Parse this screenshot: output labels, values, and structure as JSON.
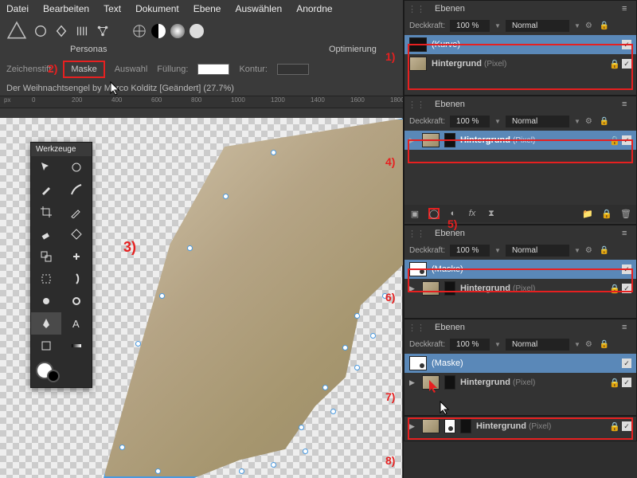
{
  "menu": [
    "Datei",
    "Bearbeiten",
    "Text",
    "Dokument",
    "Ebene",
    "Auswählen",
    "Anordne"
  ],
  "personas_label": "Personas",
  "opt_label": "Optimierung",
  "context": {
    "zeichenstift": "Zeichenstift:",
    "maske": "Maske",
    "auswahl": "Auswahl",
    "fuellung": "Füllung:",
    "kontur": "Kontur:"
  },
  "doc": "Der Weihnachtsengel by Marco Kolditz [Geändert] (27.7%)",
  "ruler_ticks": [
    "0",
    "200",
    "400",
    "600",
    "800",
    "1000",
    "1200",
    "1400",
    "1600",
    "1800"
  ],
  "tools_title": "Werkzeuge",
  "panel": {
    "title": "Ebenen",
    "opacity_label": "Deckkraft:",
    "opacity_value": "100 %",
    "blend": "Normal"
  },
  "layers": {
    "p1": {
      "curve": "(Kurve)",
      "bg": "Hintergrund",
      "bg_type": "(Pixel)"
    },
    "p2": {
      "bg": "Hintergrund",
      "bg_type": "(Pixel)"
    },
    "p3": {
      "mask": "(Maske)",
      "bg": "Hintergrund",
      "bg_type": "(Pixel)"
    },
    "p4": {
      "mask": "(Maske)",
      "bg": "Hintergrund",
      "bg_type": "(Pixel)"
    },
    "p5": {
      "bg": "Hintergrund",
      "bg_type": "(Pixel)"
    }
  },
  "annotations": {
    "a1": "1)",
    "a2": "2)",
    "a3": "3)",
    "a4": "4)",
    "a5": "5)",
    "a6": "6)",
    "a7": "7)",
    "a8": "8)"
  }
}
